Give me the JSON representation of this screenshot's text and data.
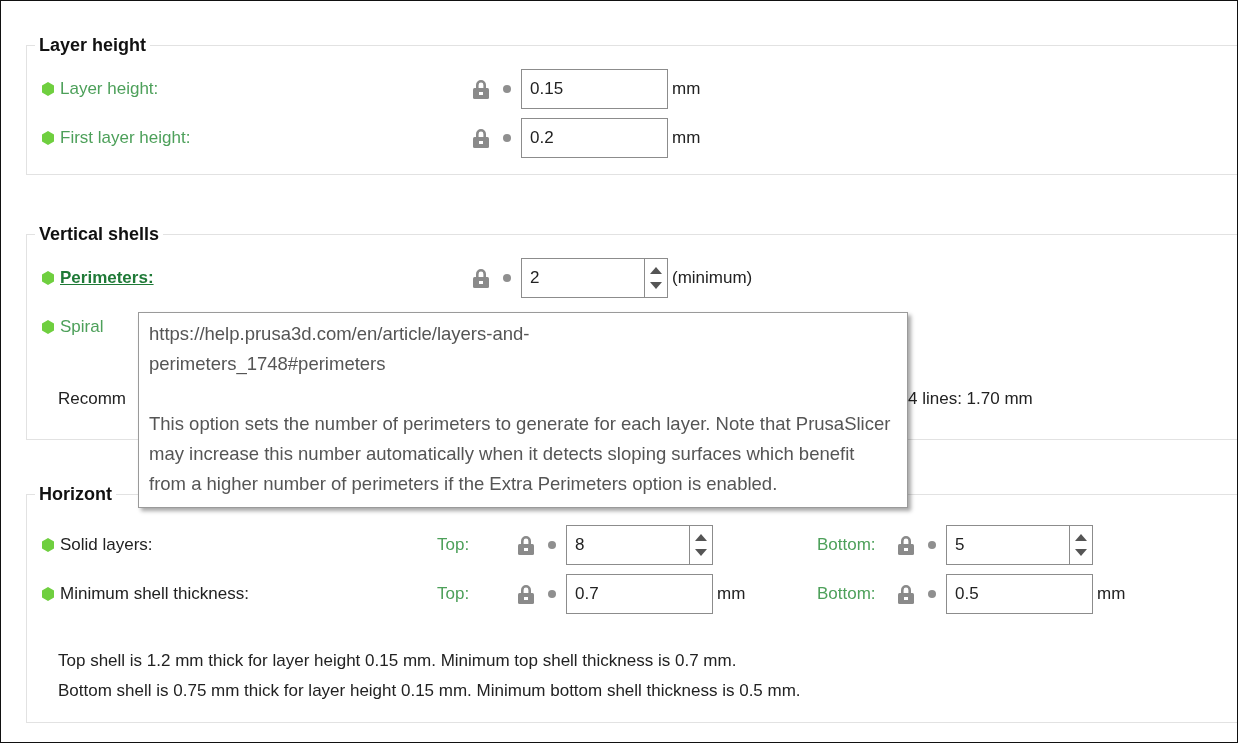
{
  "sections": [
    {
      "title": "Layer height",
      "rows": [
        {
          "kind": "option",
          "label": "Layer height:",
          "system": true,
          "hovered": false,
          "fields": [
            {
              "kind": "text",
              "value": "0.15",
              "unit": "mm"
            }
          ]
        },
        {
          "kind": "option",
          "label": "First layer height:",
          "system": true,
          "hovered": false,
          "fields": [
            {
              "kind": "text",
              "value": "0.2",
              "unit": "mm"
            }
          ]
        }
      ]
    },
    {
      "title": "Vertical shells",
      "rows": [
        {
          "kind": "option",
          "label": "Perimeters:",
          "system": true,
          "hovered": true,
          "fields": [
            {
              "kind": "spin",
              "value": "2",
              "unit": "(minimum)"
            }
          ]
        },
        {
          "kind": "option",
          "label": "Spiral",
          "system": true,
          "hovered": false
        },
        {
          "kind": "note",
          "texts": [
            "Recomm",
            "4 lines: 1.70 mm"
          ]
        }
      ]
    },
    {
      "title": "Horizont",
      "rows": [
        {
          "kind": "option",
          "label": "Solid layers:",
          "system": false,
          "hovered": false,
          "fields": [
            {
              "kind": "spin",
              "sublabel": "Top:",
              "value": "8"
            },
            {
              "kind": "spin",
              "sublabel": "Bottom:",
              "value": "5"
            }
          ]
        },
        {
          "kind": "option",
          "label": "Minimum shell thickness:",
          "system": false,
          "hovered": false,
          "fields": [
            {
              "kind": "text",
              "sublabel": "Top:",
              "value": "0.7",
              "unit": "mm"
            },
            {
              "kind": "text",
              "sublabel": "Bottom:",
              "value": "0.5",
              "unit": "mm"
            }
          ]
        },
        {
          "kind": "lines",
          "texts": [
            "Top shell is 1.2 mm thick for layer height 0.15 mm. Minimum top shell thickness is 0.7 mm.",
            "Bottom shell is 0.75 mm thick for layer height 0.15 mm. Minimum bottom shell thickness is 0.5 mm."
          ]
        }
      ]
    }
  ],
  "tooltip": {
    "link": "https://help.prusa3d.com/en/article/layers-and-perimeters_1748#perimeters",
    "text": "This option sets the number of perimeters to generate for each layer. Note that PrusaSlicer may increase this number automatically when it detects sloping surfaces which benefit from a higher number of perimeters if the Extra Perimeters option is enabled."
  }
}
